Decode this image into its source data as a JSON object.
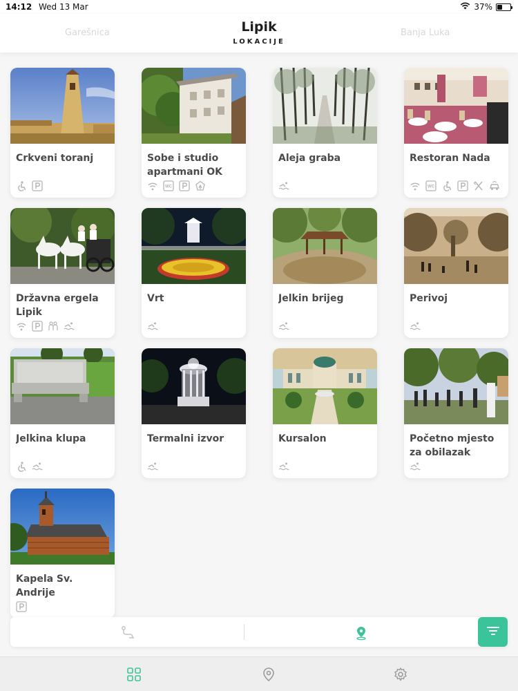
{
  "status_bar": {
    "time": "14:12",
    "date": "Wed 13 Mar",
    "battery": "37%",
    "battery_level": 0.37
  },
  "header": {
    "previous": "Garešnica",
    "title": "Lipik",
    "subtitle": "LOKACIJE",
    "next": "Banja Luka"
  },
  "amenity_icons": {
    "accessible": "wheelchair-icon",
    "parking": "parking-icon",
    "wifi": "wifi-icon",
    "wc": "wc-icon",
    "accessible_hotel": "hotel-icon",
    "restaurant": "utensils-icon",
    "swimming": "swimming-icon",
    "tourist_guide": "guide-icon",
    "car": "car-icon"
  },
  "cards": [
    {
      "title": "Crkveni toranj",
      "icons": [
        "wheelchair-icon",
        "parking-icon"
      ]
    },
    {
      "title": "Sobe i studio apartmani OK",
      "icons": [
        "wifi-icon",
        "wc-icon",
        "parking-icon",
        "hotel-icon"
      ]
    },
    {
      "title": "Aleja graba",
      "icons": [
        "swimming-icon"
      ]
    },
    {
      "title": "Restoran Nada",
      "icons": [
        "wifi-icon",
        "wc-icon",
        "wheelchair-icon",
        "parking-icon",
        "utensils-icon",
        "car-icon"
      ]
    },
    {
      "title": "Državna ergela Lipik",
      "icons": [
        "wifi-icon",
        "parking-icon",
        "guide-icon",
        "swimming-icon"
      ]
    },
    {
      "title": "Vrt",
      "icons": [
        "swimming-icon"
      ]
    },
    {
      "title": "Jelkin brijeg",
      "icons": [
        "swimming-icon"
      ]
    },
    {
      "title": "Perivoj",
      "icons": [
        "swimming-icon"
      ]
    },
    {
      "title": "Jelkina klupa",
      "icons": [
        "wheelchair-icon",
        "swimming-icon"
      ]
    },
    {
      "title": "Termalni izvor",
      "icons": [
        "swimming-icon"
      ]
    },
    {
      "title": "Kursalon",
      "icons": [
        "swimming-icon"
      ]
    },
    {
      "title": "Početno mjesto za obilazak Jelki...",
      "icons": [
        "swimming-icon"
      ]
    },
    {
      "title": "Kapela Sv. Andrije",
      "icons": [
        "parking-icon"
      ]
    }
  ],
  "colors": {
    "accent": "#3bc49a",
    "text": "#4a4a4a",
    "icon": "#b5b5b5",
    "tab_active": "#3bc49a"
  },
  "bottom_filter": {
    "option_1": "route-icon",
    "option_2": "map-pin-icon",
    "filter_button": "filter-icon"
  },
  "tab_bar": {
    "tabs": [
      "grid-icon",
      "location-icon",
      "settings-icon"
    ],
    "active": 0
  }
}
